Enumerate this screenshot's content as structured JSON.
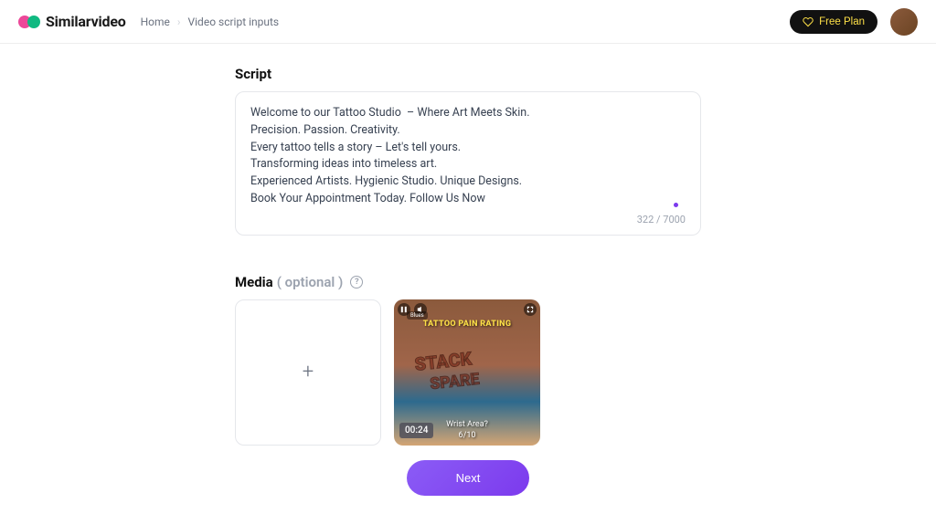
{
  "brand": "Similarvideo",
  "breadcrumb": {
    "home": "Home",
    "current": "Video script inputs"
  },
  "plan": {
    "label": "Free Plan"
  },
  "script": {
    "label": "Script",
    "value": "Welcome to our Tattoo Studio  – Where Art Meets Skin.\nPrecision. Passion. Creativity.\nEvery tattoo tells a story – Let's tell yours.\nTransforming ideas into timeless art.\nExperienced Artists. Hygienic Studio. Unique Designs.\nBook Your Appointment Today. Follow Us Now",
    "counter": "322 / 7000"
  },
  "media": {
    "label": "Media",
    "optional": "( optional )",
    "video": {
      "duration": "00:24",
      "headline": "TATTOO PAIN RATING",
      "tag": "Blues",
      "subtext": "Wrist Area?",
      "score": "6/10"
    }
  },
  "next": {
    "label": "Next"
  }
}
